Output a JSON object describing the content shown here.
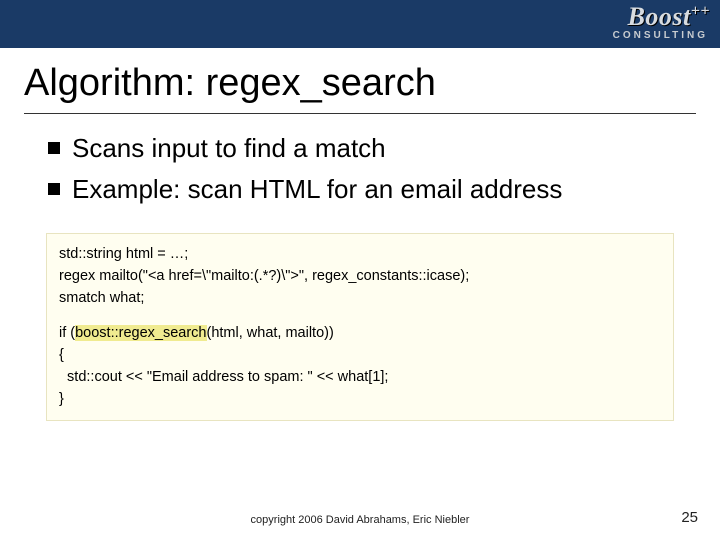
{
  "logo": {
    "main": "Boost",
    "plus": "++",
    "sub": "CONSULTING"
  },
  "title": "Algorithm: regex_search",
  "bullets": [
    "Scans input to find a match",
    "Example: scan HTML for an email address"
  ],
  "code": {
    "block1": {
      "l1": "std::string html = …;",
      "l2": "regex mailto(\"<a href=\\\"mailto:(.*?)\\\">\", regex_constants::icase);",
      "l3": "smatch what;"
    },
    "block2": {
      "l1a": "if (",
      "l1b": "boost::regex_search",
      "l1c": "(html, what, mailto))",
      "l2": "{",
      "l3": "  std::cout << \"Email address to spam: \" << what[1];",
      "l4": "}"
    }
  },
  "footer": "copyright 2006 David Abrahams, Eric Niebler",
  "page": "25"
}
